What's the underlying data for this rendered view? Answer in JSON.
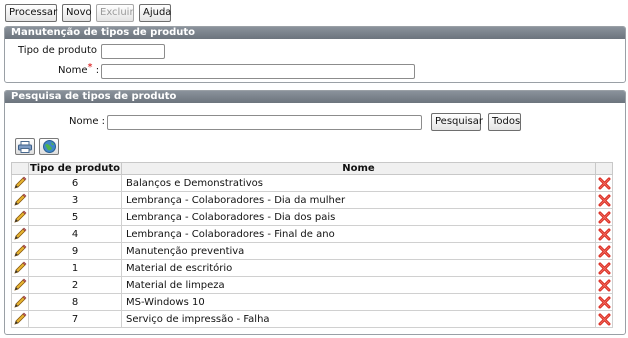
{
  "toolbar": {
    "processar": "Processar",
    "novo": "Novo",
    "excluir": "Excluir",
    "ajuda": "Ajuda"
  },
  "form": {
    "title": "Manutenção de tipos de produto",
    "tipo_label": "Tipo de produto :",
    "tipo_value": "",
    "nome_label": "Nome",
    "nome_required": "*",
    "nome_colon": ":",
    "nome_value": ""
  },
  "search": {
    "title": "Pesquisa de tipos de produto",
    "nome_label": "Nome :",
    "nome_value": "",
    "pesquisar": "Pesquisar",
    "todos": "Todos",
    "icons": [
      "printer-icon",
      "globe-icon"
    ]
  },
  "table": {
    "columns": [
      "",
      "Tipo de produto",
      "Nome",
      ""
    ],
    "rows": [
      {
        "tipo": "6",
        "nome": "Balanços e Demonstrativos"
      },
      {
        "tipo": "3",
        "nome": "Lembrança - Colaboradores - Dia da mulher"
      },
      {
        "tipo": "5",
        "nome": "Lembrança - Colaboradores - Dia dos pais"
      },
      {
        "tipo": "4",
        "nome": "Lembrança - Colaboradores - Final de ano"
      },
      {
        "tipo": "9",
        "nome": "Manutenção preventiva"
      },
      {
        "tipo": "1",
        "nome": "Material de escritório"
      },
      {
        "tipo": "2",
        "nome": "Material de limpeza"
      },
      {
        "tipo": "8",
        "nome": "MS-Windows 10"
      },
      {
        "tipo": "7",
        "nome": "Serviço de impressão - Falha"
      }
    ],
    "row_icons": {
      "edit": "pencil-icon",
      "delete": "delete-x-icon"
    }
  },
  "colors": {
    "panel_header": "#7a828b",
    "delete_red": "#d8261c",
    "pencil_yellow": "#e8b531"
  }
}
